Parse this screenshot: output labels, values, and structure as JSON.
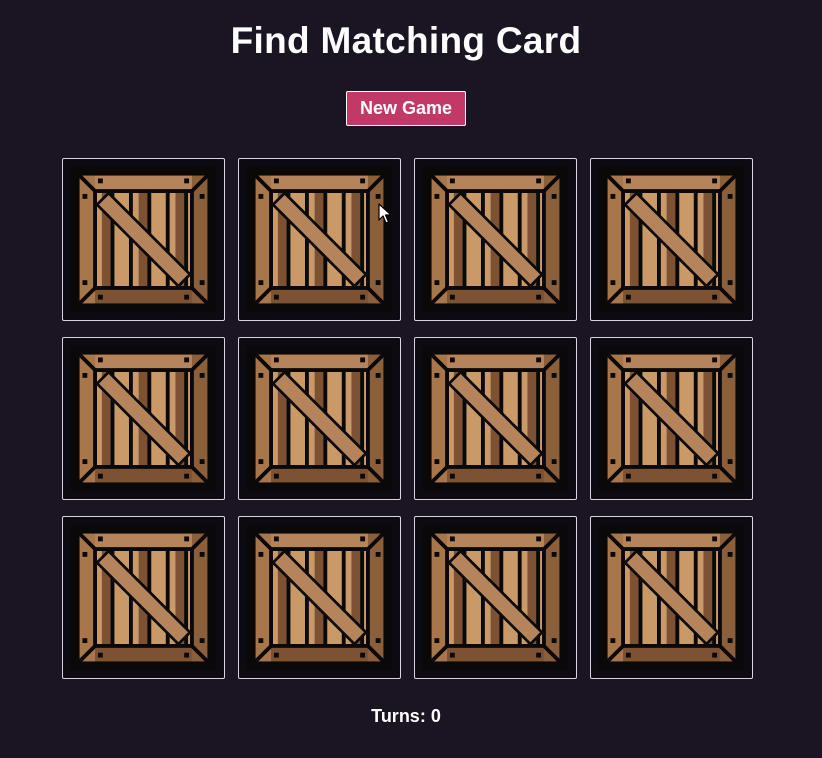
{
  "game": {
    "title": "Find Matching Card",
    "new_game_label": "New Game",
    "turns_label": "Turns:",
    "turns_value": "0",
    "turns_text": "Turns: 0",
    "card_count": 12,
    "card_back_icon": "wooden-crate-icon",
    "colors": {
      "background": "#1b1523",
      "button": "#c23866",
      "crate_light": "#c99a68",
      "crate_mid": "#a8764b",
      "crate_dark": "#7d5232",
      "outline": "#0a0808"
    }
  }
}
